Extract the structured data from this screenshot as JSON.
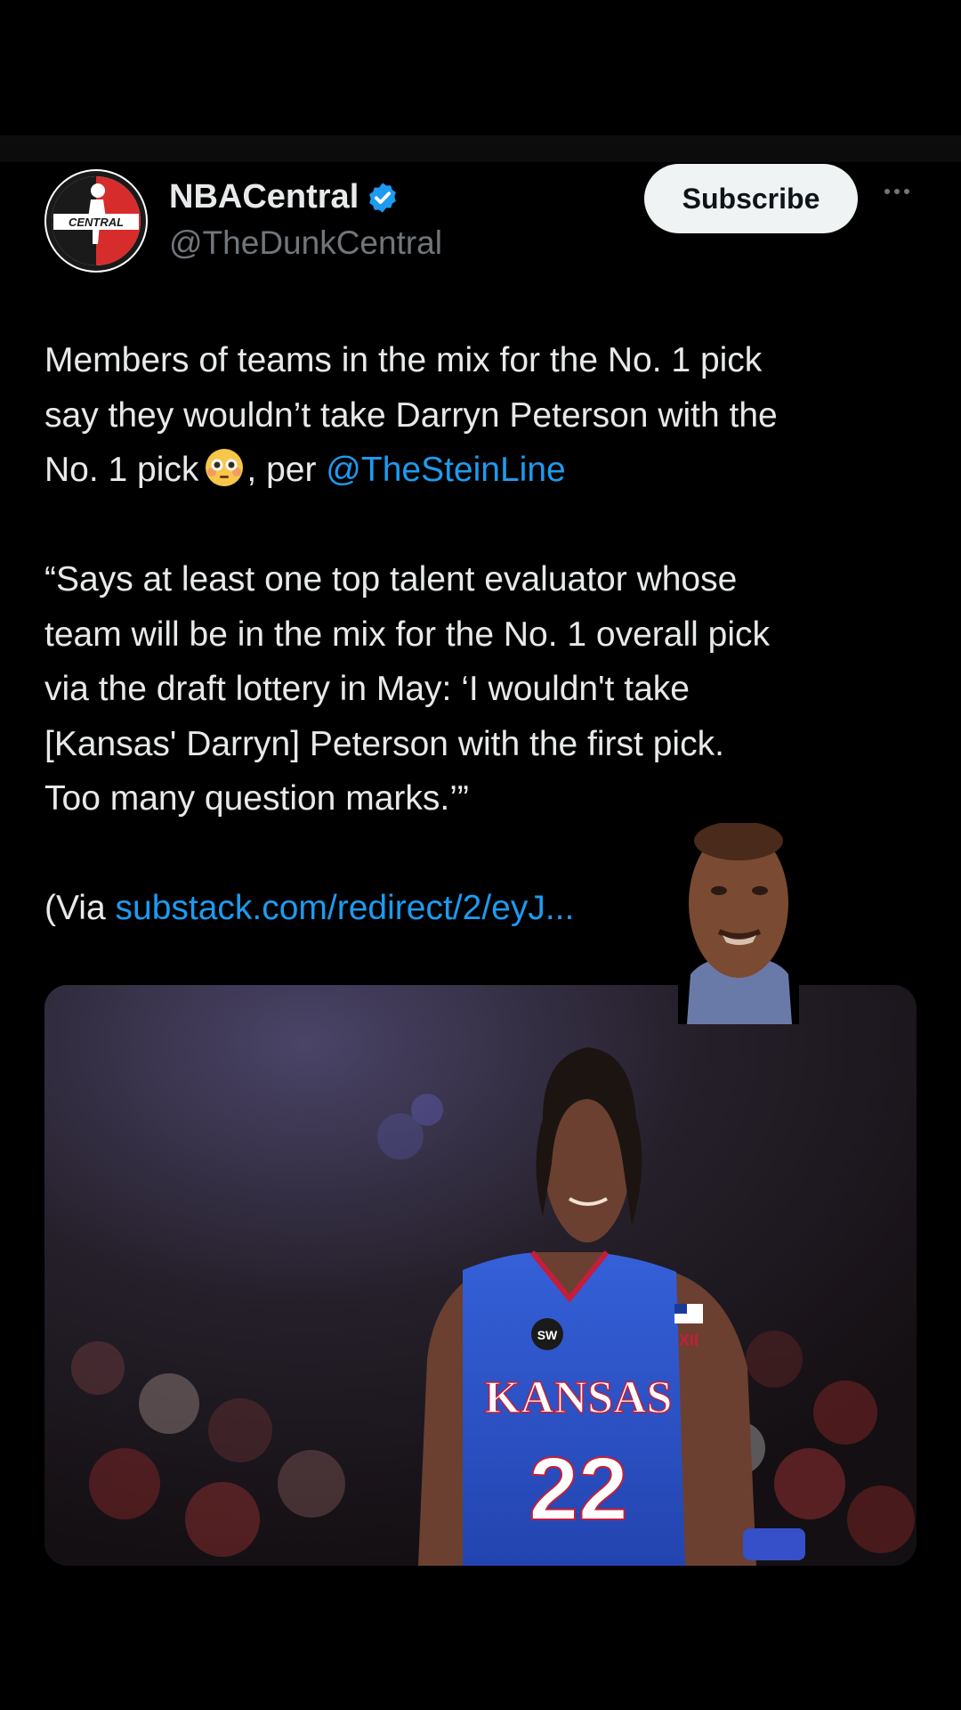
{
  "account": {
    "name": "NBACentral",
    "handle": "@TheDunkCentral",
    "avatar_text": "CENTRAL",
    "verified_icon": "verified-badge-icon"
  },
  "actions": {
    "subscribe_label": "Subscribe",
    "more_icon": "more-options-icon"
  },
  "tweet": {
    "line1": "Members of teams in the mix for the No. 1 pick",
    "line2": "say they wouldn’t take Darryn Peterson with the",
    "line3_pre": "No. 1 pick",
    "emoji": "flushed-face-emoji",
    "line3_mid": ", per ",
    "mention": "@TheSteinLine",
    "quote_line1": "“Says at least one top talent evaluator whose",
    "quote_line2": "team will be in the mix for the No. 1 overall pick",
    "quote_line3": "via the draft lottery in May: ‘I wouldn't take",
    "quote_line4": "[Kansas' Darryn] Peterson with the first pick.",
    "quote_line5": "Too many question marks.’”",
    "via_prefix": "(Via ",
    "via_link": "substack.com/redirect/2/eyJ..."
  },
  "media": {
    "jersey_team": "KANSAS",
    "jersey_number": "22",
    "jersey_patch": "SW",
    "jersey_conf": "XII"
  },
  "colors": {
    "background": "#000000",
    "link": "#1d9bf0",
    "text": "#e7e9ea",
    "muted": "#71767b",
    "jersey": "#2b52c8"
  }
}
